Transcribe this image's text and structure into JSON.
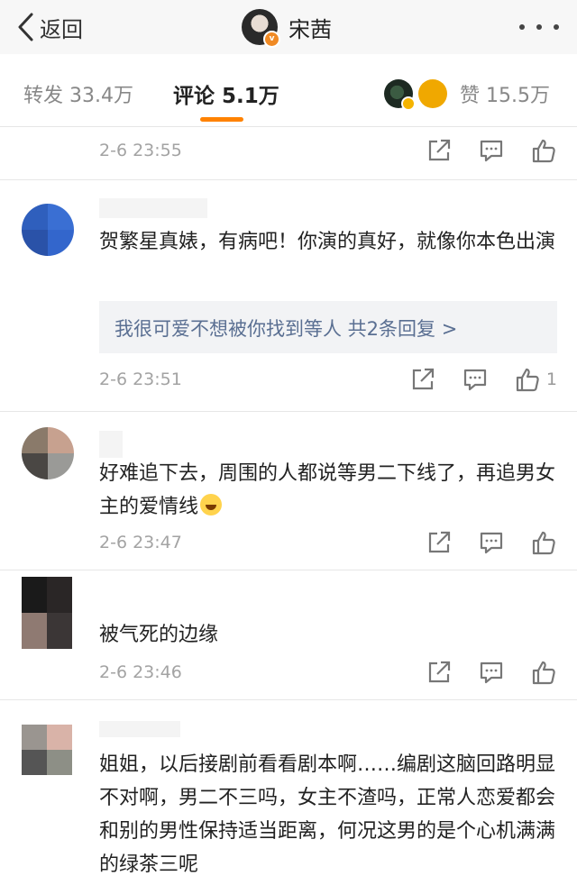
{
  "nav": {
    "back_label": "返回",
    "user_name": "宋茜",
    "verified_mark": "v"
  },
  "tabs": {
    "repost": "转发 33.4万",
    "comment": "评论 5.1万",
    "like": "赞 15.5万"
  },
  "comments": [
    {
      "time": "2-6 23:55"
    },
    {
      "text": "贺繁星真婊，有病吧！你演的真好，就像你本色出演",
      "reply_summary": "我很可爱不想被你找到等人  共2条回复 >",
      "time": "2-6 23:51",
      "like_count": "1"
    },
    {
      "text": "好难追下去，周围的人都说等男二下线了，再追男女主的爱情线",
      "emoji": "crying-laughing-emoji",
      "time": "2-6 23:47"
    },
    {
      "text": "被气死的边缘",
      "time": "2-6 23:46"
    },
    {
      "text": "姐姐，以后接剧前看看剧本啊……编剧这脑回路明显不对啊，男二不三吗，女主不渣吗，正常人恋爱都会和别的男性保持适当距离，何况这男的是个心机满满的绿茶三呢"
    }
  ],
  "colors": {
    "accent": "#ff8200",
    "link": "#5a6f92",
    "meta": "#a3a3a3"
  }
}
